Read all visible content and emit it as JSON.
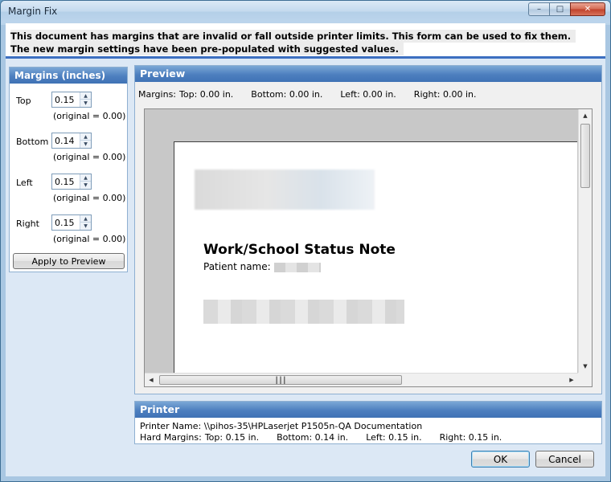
{
  "window": {
    "title": "Margin Fix"
  },
  "info": {
    "line1": "This document has margins that are invalid or fall outside printer limits. This form can be used to fix them.",
    "line2": "The new margin settings have been pre-populated with suggested values."
  },
  "margins": {
    "header": "Margins (inches)",
    "rows": [
      {
        "label": "Top",
        "value": "0.15",
        "original": "(original = 0.00)"
      },
      {
        "label": "Bottom",
        "value": "0.14",
        "original": "(original = 0.00)"
      },
      {
        "label": "Left",
        "value": "0.15",
        "original": "(original = 0.00)"
      },
      {
        "label": "Right",
        "value": "0.15",
        "original": "(original = 0.00)"
      }
    ],
    "apply_label": "Apply to Preview"
  },
  "preview": {
    "header": "Preview",
    "margins_prefix": "Margins:",
    "top": "Top: 0.00 in.",
    "bottom": "Bottom: 0.00 in.",
    "left": "Left: 0.00 in.",
    "right": "Right: 0.00 in.",
    "doc_title": "Work/School Status Note",
    "patient_label": "Patient name:"
  },
  "printer": {
    "header": "Printer",
    "name_line": "Printer Name: \\\\pihos-35\\HPLaserjet P1505n-QA Documentation",
    "hard_prefix": "Hard Margins:",
    "top": "Top: 0.15 in.",
    "bottom": "Bottom: 0.14 in.",
    "left": "Left: 0.15 in.",
    "right": "Right: 0.15 in."
  },
  "buttons": {
    "ok": "OK",
    "cancel": "Cancel"
  }
}
